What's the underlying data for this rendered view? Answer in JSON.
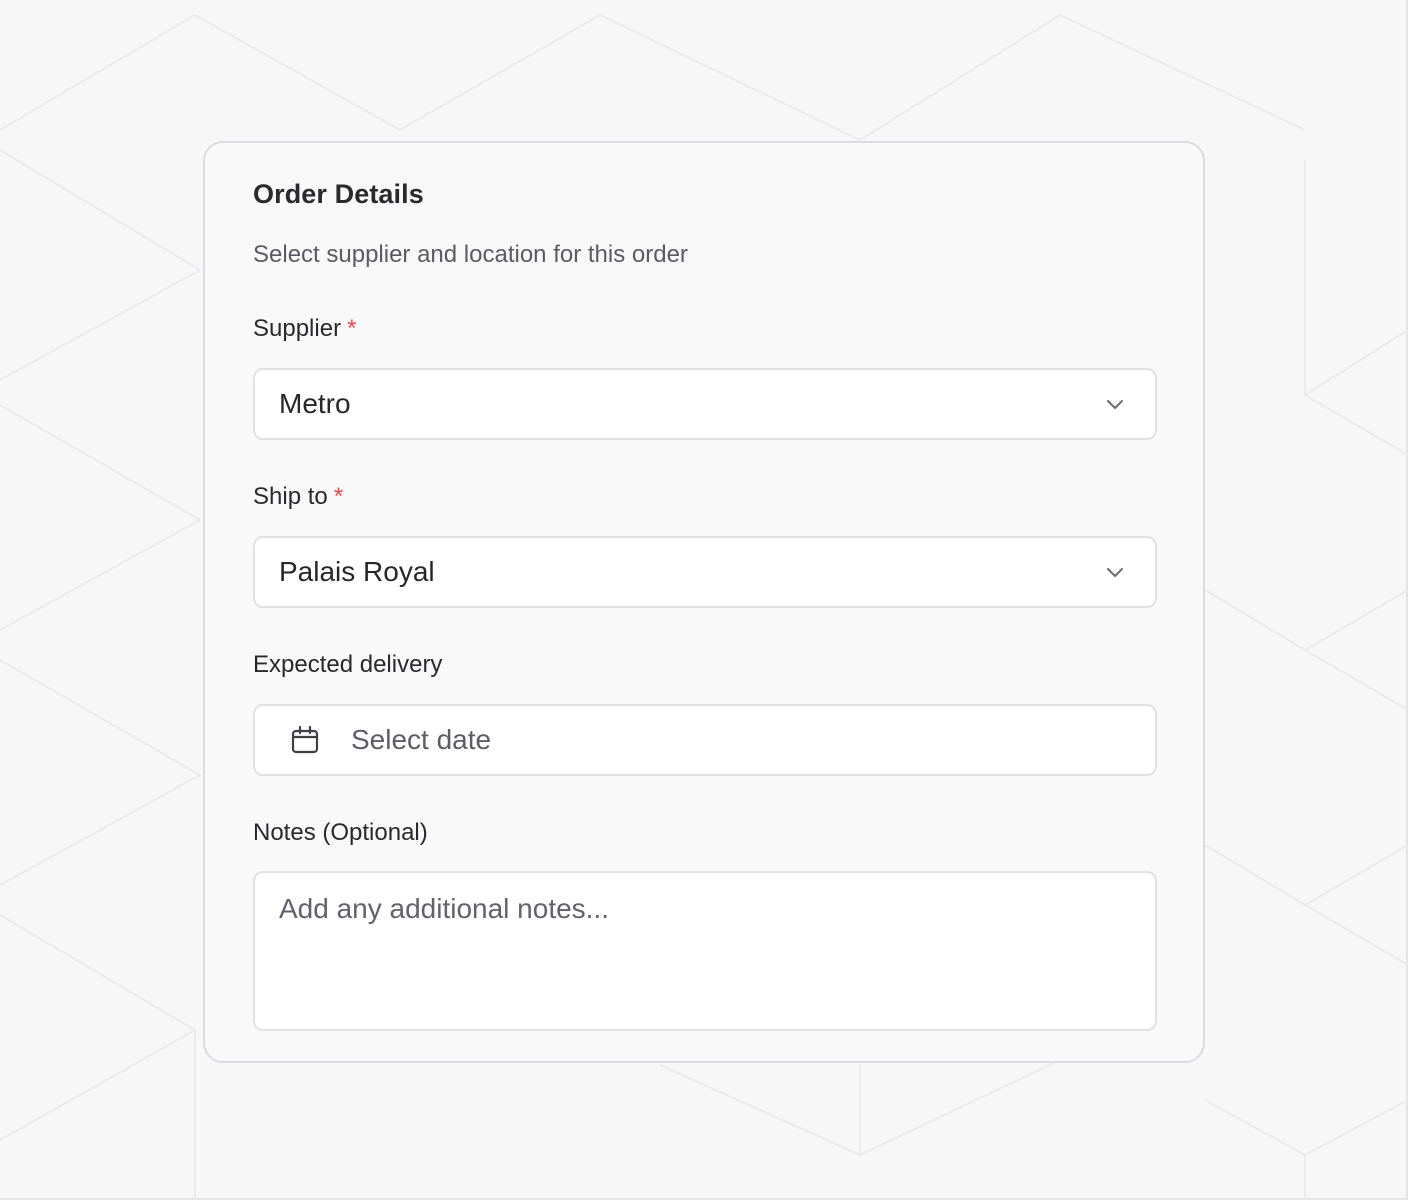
{
  "card": {
    "title": "Order Details",
    "subtitle": "Select supplier and location for this order"
  },
  "supplier": {
    "label": "Supplier",
    "required_mark": "*",
    "value": "Metro",
    "icon": "chevron-down-icon"
  },
  "ship_to": {
    "label": "Ship to",
    "required_mark": "*",
    "value": "Palais Royal",
    "icon": "chevron-down-icon"
  },
  "expected_delivery": {
    "label": "Expected delivery",
    "placeholder": "Select date",
    "icon": "calendar-icon"
  },
  "notes": {
    "label": "Notes (Optional)",
    "placeholder": "Add any additional notes..."
  },
  "colors": {
    "required": "#e5484d",
    "background": "#f7f7f8",
    "card_border": "#dcdce0"
  }
}
